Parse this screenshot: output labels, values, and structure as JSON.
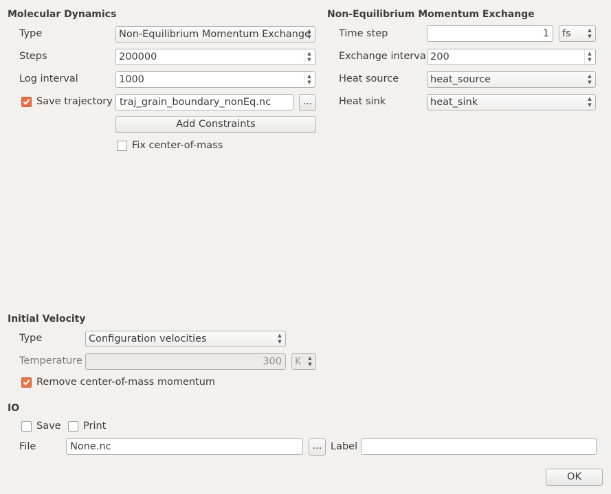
{
  "md": {
    "title": "Molecular Dynamics",
    "type_label": "Type",
    "type_value": "Non-Equilibrium Momentum Exchange",
    "steps_label": "Steps",
    "steps_value": "200000",
    "log_label": "Log interval",
    "log_value": "1000",
    "save_traj_label": "Save trajectory",
    "save_traj_checked": true,
    "traj_file": "traj_grain_boundary_nonEq.nc",
    "browse_label": "...",
    "add_constraints_label": "Add Constraints",
    "fix_com_label": "Fix center-of-mass",
    "fix_com_checked": false
  },
  "neme": {
    "title": "Non-Equilibrium Momentum Exchange",
    "timestep_label": "Time step",
    "timestep_value": "1",
    "timestep_unit": "fs",
    "exchange_label": "Exchange interval",
    "exchange_value": "200",
    "source_label": "Heat source",
    "source_value": "heat_source",
    "sink_label": "Heat sink",
    "sink_value": "heat_sink"
  },
  "iv": {
    "title": "Initial Velocity",
    "type_label": "Type",
    "type_value": "Configuration velocities",
    "temp_label": "Temperature",
    "temp_value": "300",
    "temp_unit": "K",
    "remove_com_label": "Remove center-of-mass momentum",
    "remove_com_checked": true
  },
  "io": {
    "title": "IO",
    "save_label": "Save",
    "print_label": "Print",
    "file_label": "File",
    "file_value": "None.nc",
    "browse_label": "...",
    "label_label": "Label",
    "label_value": ""
  },
  "ok_label": "OK",
  "colors": {
    "background": "#f2f1f0",
    "check_accent": "#e4754b"
  }
}
